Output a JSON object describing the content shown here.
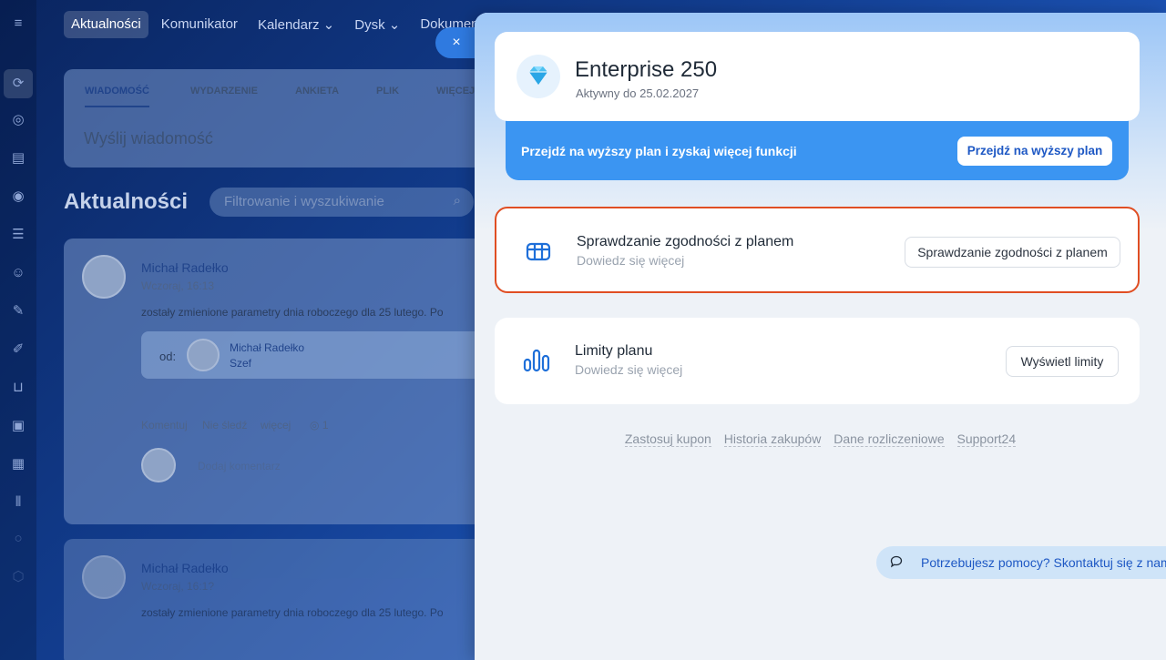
{
  "background": {
    "nav": [
      "Aktualności",
      "Komunikator",
      "Kalendarz",
      "Dysk",
      "Dokumen"
    ],
    "nav_chevrons": [
      "",
      "",
      "⌄",
      "⌄",
      ""
    ],
    "composer_tabs": [
      "WIADOMOŚĆ",
      "WYDARZENIE",
      "ANKIETA",
      "PLIK",
      "WIĘCEJ"
    ],
    "composer_placeholder": "Wyślij wiadomość",
    "feed_title": "Aktualności",
    "filter_placeholder": "Filtrowanie i wyszukiwanie",
    "post": {
      "author": "Michał Radełko",
      "time": "Wczoraj, 16:13",
      "text": "zostały zmienione parametry dnia roboczego dla 25 lutego. Po",
      "from_label": "od:",
      "from_name": "Michał Radełko",
      "from_role": "Szef",
      "actions": [
        "Komentuj",
        "Nie śledź",
        "więcej",
        "1"
      ],
      "comment_placeholder": "Dodaj komentarz"
    },
    "post2": {
      "author": "Michał Radełko",
      "time": "Wczoraj, 16:1?",
      "text": "zostały zmienione parametry dnia roboczego dla 25 lutego. Po"
    }
  },
  "close_icon": "×",
  "plan": {
    "name": "Enterprise 250",
    "active_until": "Aktywny do 25.02.2027",
    "icon": "diamond-icon"
  },
  "upgrade": {
    "text": "Przejdź na wyższy plan i zyskaj więcej funkcji",
    "button": "Przejdź na wyższy plan"
  },
  "compliance": {
    "title": "Sprawdzanie zgodności z planem",
    "subtitle": "Dowiedz się więcej",
    "button": "Sprawdzanie zgodności z planem",
    "icon": "grid-icon"
  },
  "limits": {
    "title": "Limity planu",
    "subtitle": "Dowiedz się więcej",
    "button": "Wyświetl limity",
    "icon": "bar-chart-icon"
  },
  "links": [
    "Zastosuj kupon",
    "Historia zakupów",
    "Dane rozliczeniowe",
    "Support24"
  ],
  "help": {
    "text": "Potrzebujesz pomocy? Skontaktuj się z nami"
  },
  "colors": {
    "accent": "#3b95f2",
    "highlight_border": "#e04e23",
    "link": "#1e58c4"
  }
}
